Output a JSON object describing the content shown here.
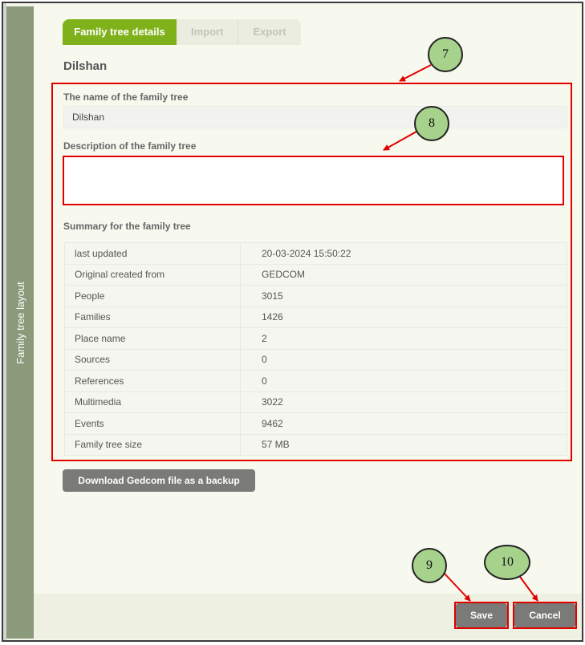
{
  "sidebar": {
    "label": "Family tree layout"
  },
  "tabs": [
    {
      "label": "Family tree details",
      "active": true
    },
    {
      "label": "Import",
      "active": false
    },
    {
      "label": "Export",
      "active": false
    }
  ],
  "tree_title": "Dilshan",
  "name_section": {
    "label": "The name of the family tree",
    "value": "Dilshan"
  },
  "description_section": {
    "label": "Description of the family tree",
    "value": ""
  },
  "summary": {
    "label": "Summary for the family tree",
    "rows": [
      {
        "key": "last updated",
        "value": "20-03-2024 15:50:22"
      },
      {
        "key": "Original created from",
        "value": "GEDCOM"
      },
      {
        "key": "People",
        "value": "3015"
      },
      {
        "key": "Families",
        "value": "1426"
      },
      {
        "key": "Place name",
        "value": "2"
      },
      {
        "key": "Sources",
        "value": "0"
      },
      {
        "key": "References",
        "value": "0"
      },
      {
        "key": "Multimedia",
        "value": "3022"
      },
      {
        "key": "Events",
        "value": "9462"
      },
      {
        "key": "Family tree size",
        "value": "57 MB"
      }
    ]
  },
  "backup_button": "Download Gedcom file as a backup",
  "footer": {
    "save_label": "Save",
    "cancel_label": "Cancel"
  },
  "callouts": [
    "7",
    "8",
    "9",
    "10"
  ],
  "colors": {
    "accent": "#7fb21a",
    "highlight": "#e00000",
    "callout_fill": "#a6d28c",
    "button": "#7a7a78"
  }
}
